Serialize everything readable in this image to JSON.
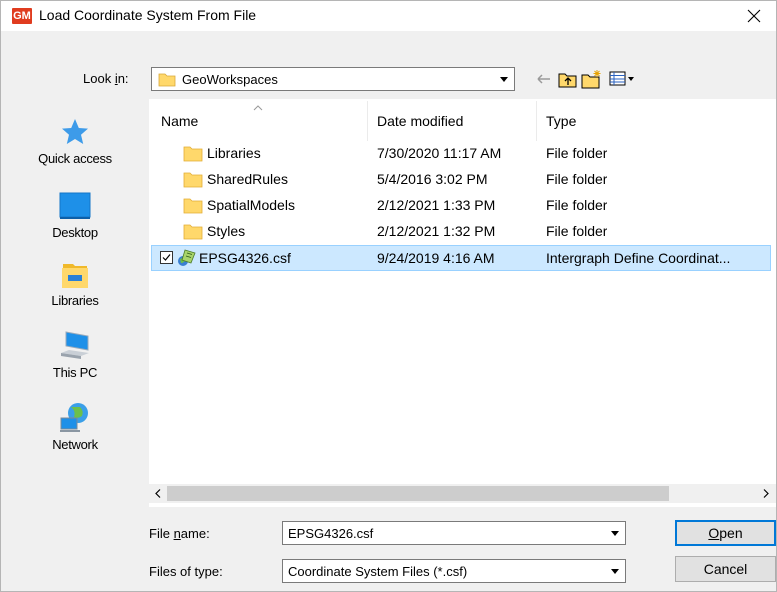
{
  "window": {
    "app_icon_text": "GM",
    "title": "Load Coordinate System From File"
  },
  "look_in": {
    "label_prefix": "Look ",
    "label_access": "i",
    "label_suffix": "n:",
    "value": "GeoWorkspaces"
  },
  "places": [
    {
      "label": "Quick access",
      "icon": "star-icon"
    },
    {
      "label": "Desktop",
      "icon": "desktop-icon"
    },
    {
      "label": "Libraries",
      "icon": "libraries-icon"
    },
    {
      "label": "This PC",
      "icon": "computer-icon"
    },
    {
      "label": "Network",
      "icon": "network-icon"
    }
  ],
  "columns": {
    "name": "Name",
    "date": "Date modified",
    "type": "Type"
  },
  "files": [
    {
      "name": "Libraries",
      "date": "7/30/2020 11:17 AM",
      "type": "File folder",
      "icon": "folder-icon"
    },
    {
      "name": "SharedRules",
      "date": "5/4/2016 3:02 PM",
      "type": "File folder",
      "icon": "folder-icon"
    },
    {
      "name": "SpatialModels",
      "date": "2/12/2021 1:33 PM",
      "type": "File folder",
      "icon": "folder-icon"
    },
    {
      "name": "Styles",
      "date": "2/12/2021 1:32 PM",
      "type": "File folder",
      "icon": "folder-icon"
    },
    {
      "name": "EPSG4326.csf",
      "date": "9/24/2019 4:16 AM",
      "type": "Intergraph Define Coordinat...",
      "icon": "csf-file-icon"
    }
  ],
  "file_name": {
    "label_prefix": "File ",
    "label_access": "n",
    "label_suffix": "ame:",
    "value": "EPSG4326.csf"
  },
  "file_type": {
    "label": "Files of type:",
    "value": "Coordinate System Files (*.csf)"
  },
  "buttons": {
    "open_access": "O",
    "open_rest": "pen",
    "cancel": "Cancel"
  },
  "colors": {
    "selection": "#cce8ff",
    "accent": "#0078d7",
    "app_icon": "#e03c1f"
  }
}
